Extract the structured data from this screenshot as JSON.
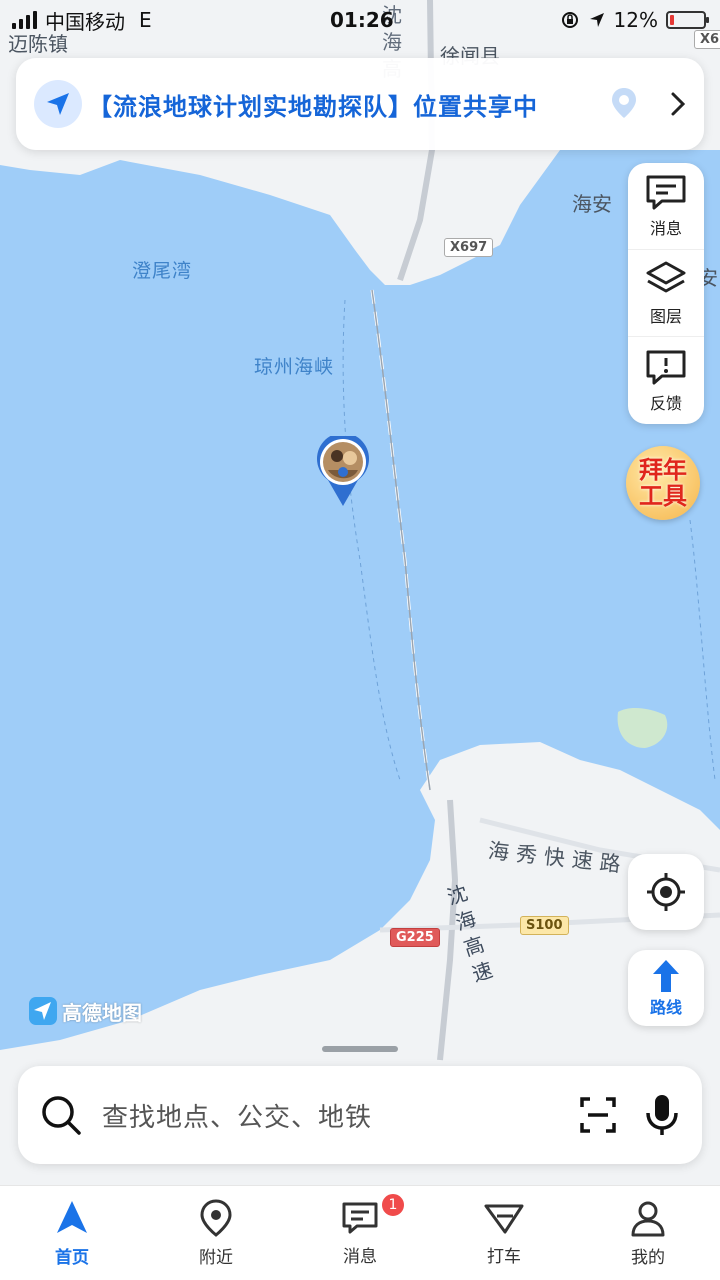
{
  "status_bar": {
    "carrier": "中国移动",
    "network": "E",
    "time": "01:26",
    "battery": "12%",
    "battery_level": 0.12
  },
  "share_banner": {
    "text": "【流浪地球计划实地勘探队】位置共享中"
  },
  "map": {
    "water_labels": [
      "澄尾湾",
      "琼州海峡"
    ],
    "place_labels": [
      "迈陈镇",
      "徐闻县",
      "海安",
      "安"
    ],
    "roads": {
      "x697": "X697",
      "x6": "X6",
      "s100": "S100",
      "g225": "G225",
      "haixiu": "海秀快速路",
      "raohai": "沈海高速",
      "top_vertical": "沈海高"
    }
  },
  "side_tools": {
    "messages": "消息",
    "layers": "图层",
    "feedback": "反馈"
  },
  "promo": {
    "text": "拜年工具"
  },
  "route_button": {
    "label": "路线"
  },
  "watermark": {
    "text": "高德地图"
  },
  "search": {
    "placeholder": "查找地点、公交、地铁"
  },
  "tabs": [
    {
      "label": "首页",
      "icon": "navigation-arrow-icon"
    },
    {
      "label": "附近",
      "icon": "location-pin-icon"
    },
    {
      "label": "消息",
      "icon": "message-icon",
      "badge": "1"
    },
    {
      "label": "打车",
      "icon": "taxi-icon"
    },
    {
      "label": "我的",
      "icon": "person-icon"
    }
  ],
  "colors": {
    "water": "#9fcdf8",
    "land": "#f1f3f5",
    "accent": "#1a73e8"
  }
}
